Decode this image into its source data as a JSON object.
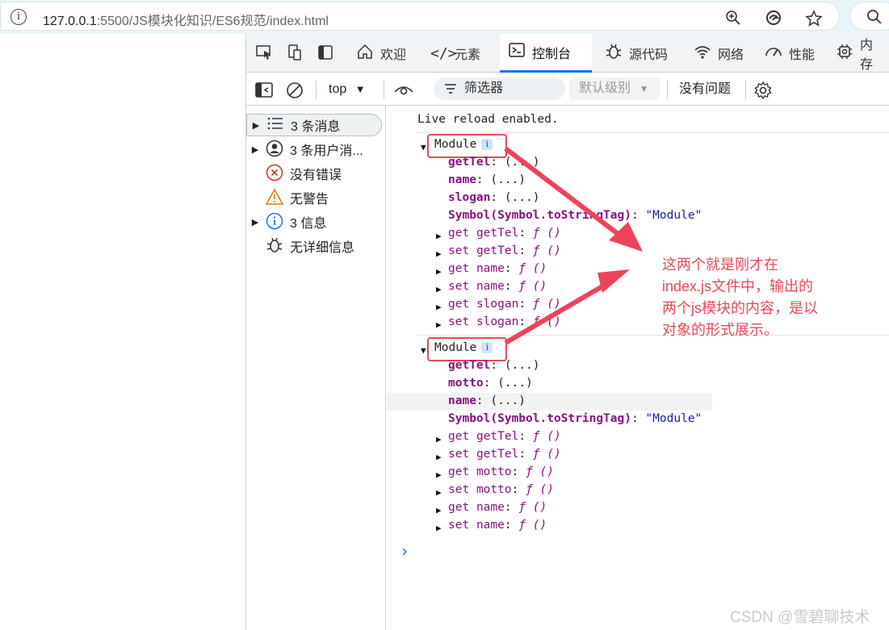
{
  "address_bar": {
    "info_icon": "i",
    "url_host": "127.0.0.1",
    "url_rest": ":5500/JS模块化知识/ES6规范/index.html"
  },
  "devtools": {
    "tabs": [
      {
        "label": "欢迎",
        "icon": "home-icon"
      },
      {
        "label": "元素",
        "icon": "code-icon"
      },
      {
        "label": "控制台",
        "icon": "console-icon"
      },
      {
        "label": "源代码",
        "icon": "bug-icon"
      },
      {
        "label": "网络",
        "icon": "wifi-icon"
      },
      {
        "label": "性能",
        "icon": "gauge-icon"
      },
      {
        "label": "内存",
        "icon": "chip-icon"
      }
    ],
    "toolbar": {
      "context": "top",
      "filter_label": "筛选器",
      "level_label": "默认级别",
      "issues_label": "没有问题"
    },
    "sidebar": [
      {
        "label": "3 条消息",
        "icon": "list-icon",
        "expandable": true,
        "selected": true
      },
      {
        "label": "3 条用户消...",
        "icon": "user-icon",
        "expandable": true
      },
      {
        "label": "没有错误",
        "icon": "error-icon",
        "expandable": false
      },
      {
        "label": "无警告",
        "icon": "warning-icon",
        "expandable": false
      },
      {
        "label": "3 信息",
        "icon": "info-icon",
        "expandable": true
      },
      {
        "label": "无详细信息",
        "icon": "bug-icon",
        "expandable": false
      }
    ],
    "console": {
      "live_reload": "Live reload enabled.",
      "module_label": "Module",
      "module1": {
        "props": [
          {
            "key": "getTel",
            "val": "(...)"
          },
          {
            "key": "name",
            "val": "(...)"
          },
          {
            "key": "slogan",
            "val": "(...)"
          }
        ],
        "symbol_key": "Symbol(Symbol.toStringTag)",
        "symbol_val": "\"Module\"",
        "accessors": [
          {
            "kind": "get",
            "name": "getTel"
          },
          {
            "kind": "set",
            "name": "getTel"
          },
          {
            "kind": "get",
            "name": "name"
          },
          {
            "kind": "set",
            "name": "name"
          },
          {
            "kind": "get",
            "name": "slogan"
          },
          {
            "kind": "set",
            "name": "slogan"
          }
        ]
      },
      "module2": {
        "props": [
          {
            "key": "getTel",
            "val": "(...)"
          },
          {
            "key": "motto",
            "val": "(...)"
          },
          {
            "key": "name",
            "val": "(...)"
          }
        ],
        "symbol_key": "Symbol(Symbol.toStringTag)",
        "symbol_val": "\"Module\"",
        "accessors": [
          {
            "kind": "get",
            "name": "getTel"
          },
          {
            "kind": "set",
            "name": "getTel"
          },
          {
            "kind": "get",
            "name": "motto"
          },
          {
            "kind": "set",
            "name": "motto"
          },
          {
            "kind": "get",
            "name": "name"
          },
          {
            "kind": "set",
            "name": "name"
          }
        ]
      },
      "fn_text": "ƒ ()",
      "prompt": "›"
    }
  },
  "annotation": {
    "lines": [
      "这两个就是刚才在",
      "index.js文件中，输出的",
      "两个js模块的内容，是以",
      "对象的形式展示。"
    ],
    "color": "#e8485a"
  },
  "watermark": "CSDN @雪碧聊技术"
}
